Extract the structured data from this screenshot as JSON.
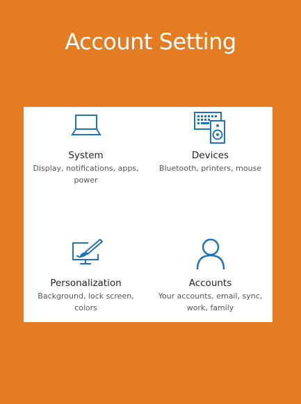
{
  "page": {
    "title": "Account Setting"
  },
  "colors": {
    "background": "#E47D22",
    "panel": "#FFFFFF",
    "icon_accent": "#1E73BE",
    "label_text": "#222222",
    "description_text": "#555555"
  },
  "settings": {
    "tiles": [
      {
        "label": "System",
        "description": "Display, notifications, apps, power",
        "icon": "laptop-icon"
      },
      {
        "label": "Devices",
        "description": "Bluetooth, printers, mouse",
        "icon": "keyboard-speaker-icon"
      },
      {
        "label": "Personalization",
        "description": "Background, lock screen, colors",
        "icon": "paintbrush-monitor-icon"
      },
      {
        "label": "Accounts",
        "description": "Your accounts, email, sync, work, family",
        "icon": "person-icon"
      }
    ]
  }
}
